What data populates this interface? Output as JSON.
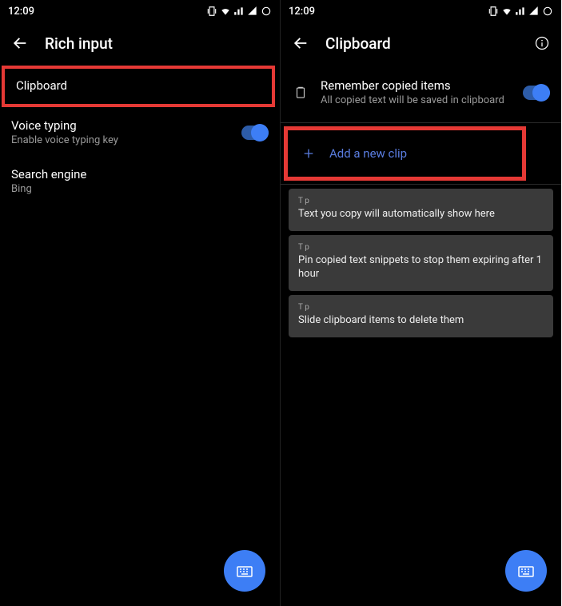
{
  "status_time": "12:09",
  "left": {
    "title": "Rich input",
    "row1": {
      "title": "Clipboard"
    },
    "row2": {
      "title": "Voice typing",
      "sub": "Enable voice typing key"
    },
    "row3": {
      "title": "Search engine",
      "sub": "Bing"
    }
  },
  "right": {
    "title": "Clipboard",
    "remember": {
      "title": "Remember copied items",
      "sub": "All copied text will be saved in clipboard"
    },
    "add_clip": "Add a new clip",
    "tip_label": "T p",
    "tip1": "Text you copy will automatically show here",
    "tip2": "Pin copied text snippets to stop them expiring after 1 hour",
    "tip3": "Slide clipboard items to delete them"
  }
}
